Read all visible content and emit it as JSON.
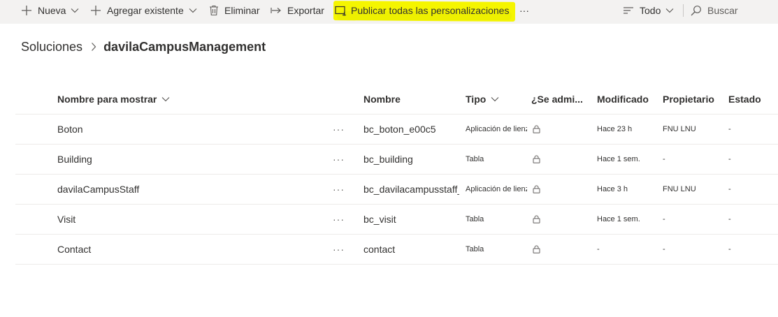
{
  "command_bar": {
    "new_label": "Nueva",
    "add_existing_label": "Agregar existente",
    "delete_label": "Eliminar",
    "export_label": "Exportar",
    "publish_label": "Publicar todas las personalizaciones",
    "more_label": "···",
    "filter_label": "Todo",
    "search_placeholder": "Buscar",
    "highlight_color": "#f5f500"
  },
  "breadcrumb": {
    "root": "Soluciones",
    "current": "davilaCampusManagement"
  },
  "table": {
    "headers": {
      "display_name": "Nombre para mostrar",
      "name": "Nombre",
      "type": "Tipo",
      "managed": "¿Se admi...",
      "modified": "Modificado",
      "owner": "Propietario",
      "status": "Estado"
    },
    "rows": [
      {
        "display_name": "Boton",
        "more": "···",
        "name": "bc_boton_e00c5",
        "type": "Aplicación de lienzo",
        "managed": "lock-icon",
        "modified": "Hace 23 h",
        "owner": "FNU LNU",
        "status": "-"
      },
      {
        "display_name": "Building",
        "more": "···",
        "name": "bc_building",
        "type": "Tabla",
        "managed": "lock-icon",
        "modified": "Hace 1 sem.",
        "owner": "-",
        "status": "-"
      },
      {
        "display_name": "davilaCampusStaff",
        "more": "···",
        "name": "bc_davilacampusstaff_",
        "type": "Aplicación de lienzo",
        "managed": "lock-icon",
        "modified": "Hace 3 h",
        "owner": "FNU LNU",
        "status": "-"
      },
      {
        "display_name": "Visit",
        "more": "···",
        "name": "bc_visit",
        "type": "Tabla",
        "managed": "lock-icon",
        "modified": "Hace 1 sem.",
        "owner": "-",
        "status": "-"
      },
      {
        "display_name": "Contact",
        "more": "···",
        "name": "contact",
        "type": "Tabla",
        "managed": "lock-icon",
        "modified": "-",
        "owner": "-",
        "status": "-"
      }
    ]
  }
}
